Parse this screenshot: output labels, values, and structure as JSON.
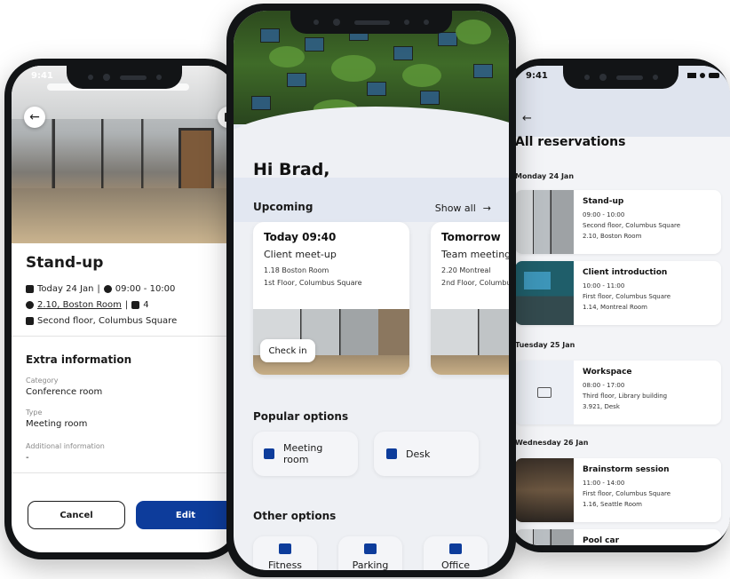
{
  "left_phone": {
    "status_time": "9:41",
    "title": "Stand-up",
    "date": "Today 24 Jan",
    "time": "09:00 - 10:00",
    "room": "2.10, Boston Room",
    "people": "4",
    "location": "Second floor, Columbus Square",
    "extra_heading": "Extra information",
    "category_label": "Category",
    "category_value": "Conference room",
    "type_label": "Type",
    "type_value": "Meeting room",
    "additional_label": "Additional information",
    "additional_value": "-",
    "cancel_label": "Cancel",
    "edit_label": "Edit",
    "separator": "|"
  },
  "center_phone": {
    "greeting": "Hi Brad,",
    "upcoming_label": "Upcoming",
    "show_all_label": "Show all",
    "cards": [
      {
        "when": "Today 09:40",
        "title": "Client meet-up",
        "room": "1.18 Boston Room",
        "location": "1st Floor, Columbus Square",
        "action": "Check in"
      },
      {
        "when": "Tomorrow",
        "title": "Team meeting",
        "room": "2.20 Montreal",
        "location": "2nd Floor, Columbus Square",
        "action": ""
      }
    ],
    "popular_label": "Popular options",
    "popular": [
      {
        "label": "Meeting room"
      },
      {
        "label": "Desk"
      }
    ],
    "other_label": "Other options",
    "other": [
      {
        "label": "Fitness"
      },
      {
        "label": "Parking"
      },
      {
        "label": "Office"
      }
    ]
  },
  "right_phone": {
    "status_time": "9:41",
    "title": "All reservations",
    "days": [
      {
        "day": "Monday 24 Jan",
        "items": [
          {
            "title": "Stand-up",
            "time": "09:00 - 10:00",
            "location": "Second floor, Columbus Square",
            "room": "2.10, Boston Room"
          },
          {
            "title": "Client introduction",
            "time": "10:00 - 11:00",
            "location": "First floor, Columbus Square",
            "room": "1.14, Montreal Room"
          }
        ]
      },
      {
        "day": "Tuesday 25 Jan",
        "items": [
          {
            "title": "Workspace",
            "time": "08:00 - 17:00",
            "location": "Third floor, Library building",
            "room": "3.921, Desk"
          }
        ]
      },
      {
        "day": "Wednesday 26 Jan",
        "items": [
          {
            "title": "Brainstorm session",
            "time": "11:00 - 14:00",
            "location": "First floor, Columbus Square",
            "room": "1.16, Seattle Room"
          },
          {
            "title": "Pool car",
            "time": "",
            "location": "",
            "room": ""
          }
        ]
      }
    ]
  },
  "colors": {
    "primary": "#0d3c9b",
    "frame": "#121416",
    "background_tint": "#e2e7f1"
  }
}
